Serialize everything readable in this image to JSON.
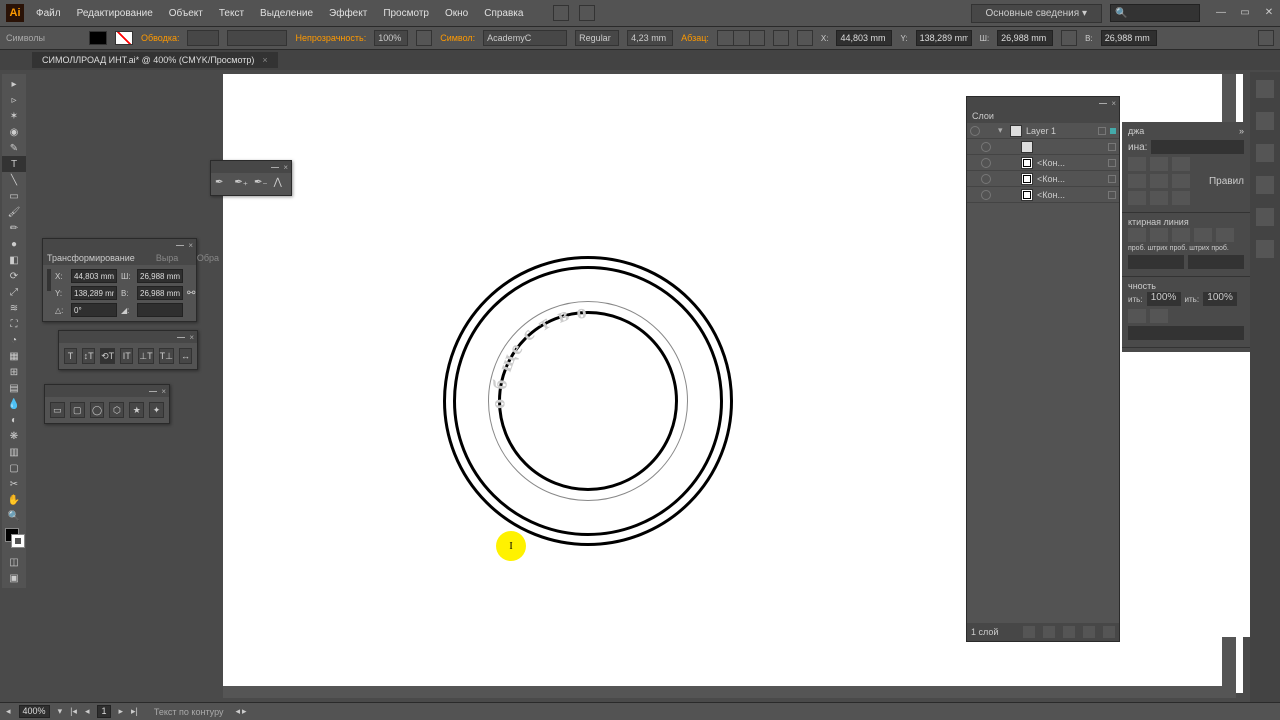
{
  "app_badge": "Ai",
  "menu": [
    "Файл",
    "Редактирование",
    "Объект",
    "Текст",
    "Выделение",
    "Эффект",
    "Просмотр",
    "Окно",
    "Справка"
  ],
  "workspace": "Основные сведения",
  "options": {
    "panel_label": "Символы",
    "stroke_label": "Обводка:",
    "stroke_val": "",
    "opacity_label": "Непрозрачность:",
    "opacity_val": "100%",
    "char_label": "Символ:",
    "font": "AcademyC",
    "style": "Regular",
    "size": "4,23 mm",
    "para_label": "Абзац:",
    "xw": "44,803 mm",
    "yh": "138,289 mm",
    "w": "26,988 mm",
    "h": "26,988 mm"
  },
  "doc_tab": "СИМОЛЛРОАД ИНТ.ai* @ 400% (CMYK/Просмотр)",
  "transform": {
    "title": "Трансформирование",
    "tab2": "Выра",
    "tab3": "Обра",
    "x": "44,803 mm",
    "y": "138,289 mm",
    "w": "26,988 mm",
    "h": "26,988 mm",
    "ang": "0°",
    "shear": ""
  },
  "type_path": {
    "options": [
      "T",
      "↕T",
      "⟲T",
      "IT",
      "⊥T",
      "T⊥",
      "↔"
    ]
  },
  "seal_text": "общество",
  "cursor_char": "I",
  "layers": {
    "title": "Слои",
    "top": "Layer 1",
    "items": [
      "",
      "<Кон...",
      "<Кон...",
      "<Кон..."
    ],
    "footer": "1 слой"
  },
  "right_panel": {
    "tab": "джа",
    "stroke_title": "ина:",
    "dash_title": "ктирная линия",
    "captions": [
      "проб.",
      "штрих",
      "проб.",
      "штрих",
      "проб."
    ],
    "opacity_tab": "чность",
    "op1": "100%",
    "op2": "100%",
    "btn": "Правил"
  },
  "bottom": {
    "zoom": "400%",
    "page": "1",
    "status": "Текст по контуру"
  }
}
